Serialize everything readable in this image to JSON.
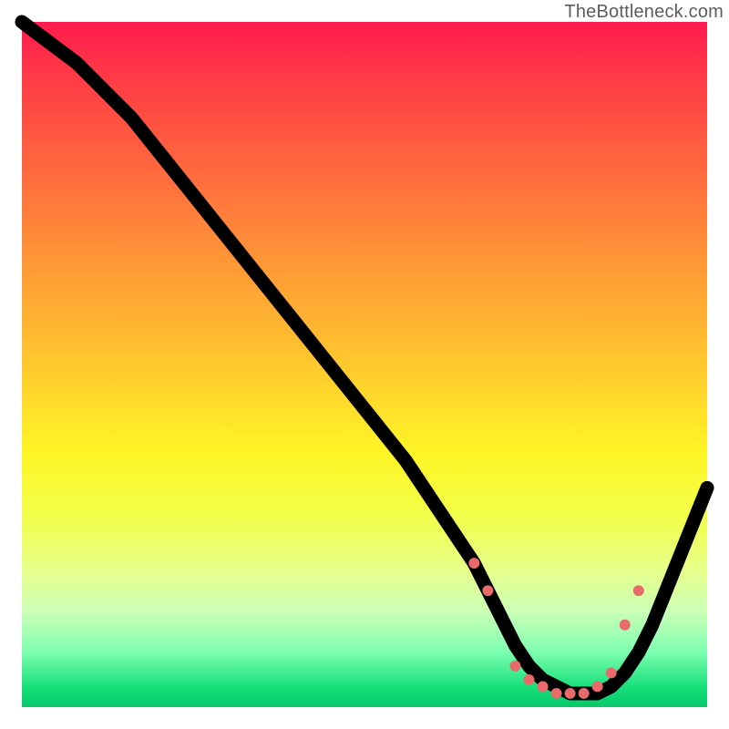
{
  "watermark": "TheBottleneck.com",
  "chart_data": {
    "type": "line",
    "title": "",
    "xlabel": "",
    "ylabel": "",
    "xlim": [
      0,
      100
    ],
    "ylim": [
      0,
      100
    ],
    "grid": false,
    "series": [
      {
        "name": "curve",
        "x": [
          0,
          4,
          8,
          12,
          16,
          20,
          24,
          28,
          32,
          36,
          40,
          44,
          48,
          52,
          56,
          60,
          64,
          66,
          68,
          70,
          72,
          74,
          76,
          78,
          80,
          82,
          84,
          86,
          88,
          90,
          92,
          94,
          96,
          98,
          100
        ],
        "y": [
          100,
          97,
          94,
          90,
          86,
          81,
          76,
          71,
          66,
          61,
          56,
          51,
          46,
          41,
          36,
          30,
          24,
          21,
          17,
          13,
          9,
          6,
          4,
          3,
          2,
          2,
          2,
          3,
          5,
          8,
          12,
          17,
          22,
          27,
          32
        ]
      }
    ],
    "highlight_points": {
      "name": "red-dots",
      "x": [
        66,
        68,
        72,
        74,
        76,
        78,
        80,
        82,
        84,
        86,
        88,
        90
      ],
      "y": [
        21,
        17,
        6,
        4,
        3,
        2,
        2,
        2,
        3,
        5,
        12,
        17
      ]
    },
    "background_gradient": {
      "top": "#ff1a4d",
      "mid": "#fff626",
      "bottom": "#06c96b"
    }
  }
}
